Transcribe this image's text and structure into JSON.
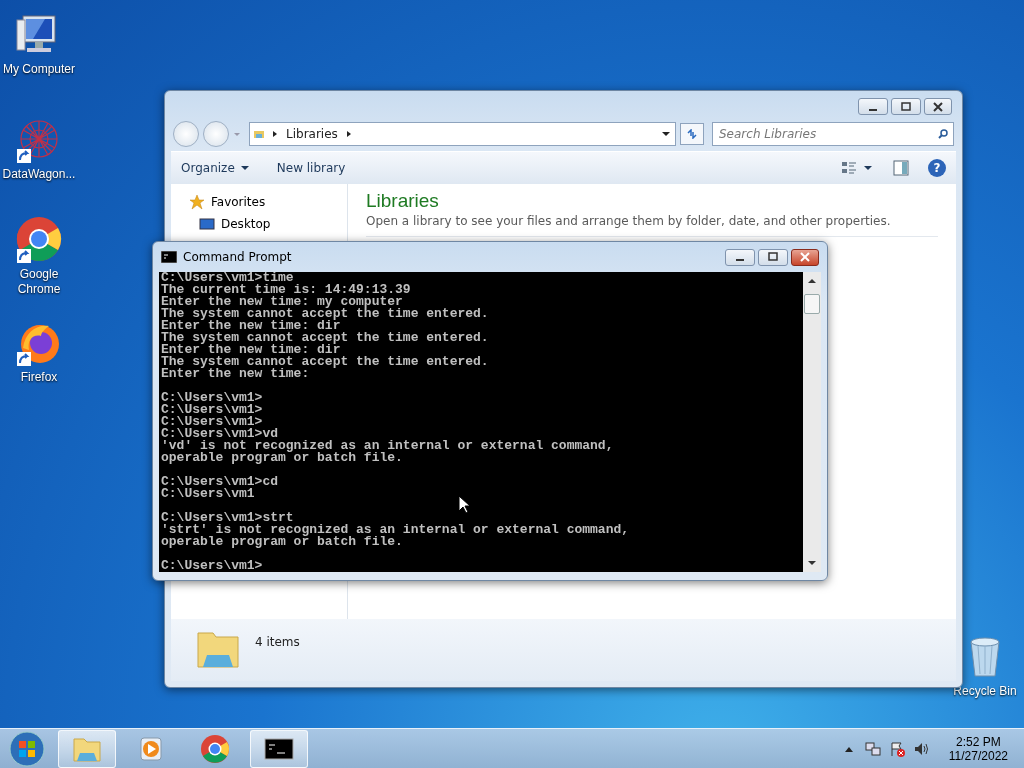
{
  "desktop_icons": [
    {
      "kind": "computer",
      "label": "My Computer",
      "shortcut": false
    },
    {
      "kind": "molecule",
      "label": "DataWagon...",
      "shortcut": true
    },
    {
      "kind": "chrome",
      "label": "Google Chrome",
      "shortcut": true
    },
    {
      "kind": "firefox",
      "label": "Firefox",
      "shortcut": true
    },
    {
      "kind": "recycle",
      "label": "Recycle Bin",
      "shortcut": false
    }
  ],
  "explorer": {
    "address": [
      "Libraries"
    ],
    "search": {
      "placeholder": "Search Libraries"
    },
    "toolbar": [
      {
        "label": "Organize",
        "dropdown": true
      },
      {
        "label": "New library",
        "dropdown": false
      }
    ],
    "nav": {
      "group": "Favorites",
      "items": [
        "Desktop"
      ]
    },
    "heading": "Libraries",
    "description": "Open a library to see your files and arrange them by folder, date, and other properties.",
    "help": "?",
    "details": "4 items"
  },
  "console": {
    "title": "Command Prompt",
    "blocks": [
      [
        "C:\\Users\\vm1>time",
        "The current time is: 14:49:13.39",
        "Enter the new time: my computer",
        "The system cannot accept the time entered.",
        "Enter the new time: dir",
        "The system cannot accept the time entered.",
        "Enter the new time: dir",
        "The system cannot accept the time entered.",
        "Enter the new time:"
      ],
      [
        "C:\\Users\\vm1>",
        "C:\\Users\\vm1>",
        "C:\\Users\\vm1>",
        "C:\\Users\\vm1>vd",
        "'vd' is not recognized as an internal or external command,",
        "operable program or batch file."
      ],
      [
        "C:\\Users\\vm1>cd",
        "C:\\Users\\vm1"
      ],
      [
        "C:\\Users\\vm1>strt",
        "'strt' is not recognized as an internal or external command,",
        "operable program or batch file."
      ],
      [
        "C:\\Users\\vm1>"
      ]
    ]
  },
  "taskbar": {
    "items": [
      {
        "kind": "explorer",
        "selected": true
      },
      {
        "kind": "media",
        "selected": false
      },
      {
        "kind": "chrome",
        "selected": false
      },
      {
        "kind": "console",
        "selected": true
      }
    ],
    "tray": [
      {
        "kind": "arrow"
      },
      {
        "kind": "network"
      },
      {
        "kind": "flag"
      },
      {
        "kind": "speaker"
      }
    ],
    "time": "2:52 PM",
    "date": "11/27/2022"
  }
}
